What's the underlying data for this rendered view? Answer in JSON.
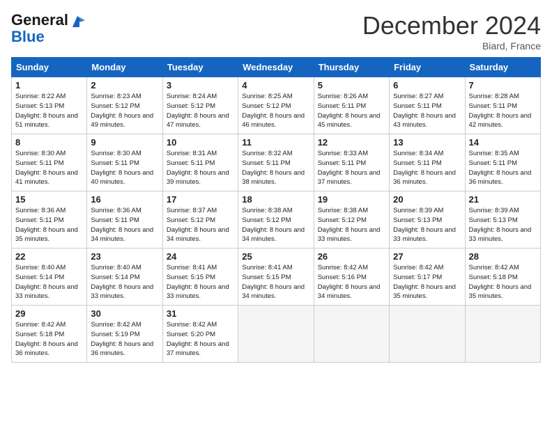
{
  "header": {
    "logo_general": "General",
    "logo_blue": "Blue",
    "month_title": "December 2024",
    "location": "Biard, France"
  },
  "days_of_week": [
    "Sunday",
    "Monday",
    "Tuesday",
    "Wednesday",
    "Thursday",
    "Friday",
    "Saturday"
  ],
  "weeks": [
    [
      {
        "day": "1",
        "sunrise": "Sunrise: 8:22 AM",
        "sunset": "Sunset: 5:13 PM",
        "daylight": "Daylight: 8 hours and 51 minutes."
      },
      {
        "day": "2",
        "sunrise": "Sunrise: 8:23 AM",
        "sunset": "Sunset: 5:12 PM",
        "daylight": "Daylight: 8 hours and 49 minutes."
      },
      {
        "day": "3",
        "sunrise": "Sunrise: 8:24 AM",
        "sunset": "Sunset: 5:12 PM",
        "daylight": "Daylight: 8 hours and 47 minutes."
      },
      {
        "day": "4",
        "sunrise": "Sunrise: 8:25 AM",
        "sunset": "Sunset: 5:12 PM",
        "daylight": "Daylight: 8 hours and 46 minutes."
      },
      {
        "day": "5",
        "sunrise": "Sunrise: 8:26 AM",
        "sunset": "Sunset: 5:11 PM",
        "daylight": "Daylight: 8 hours and 45 minutes."
      },
      {
        "day": "6",
        "sunrise": "Sunrise: 8:27 AM",
        "sunset": "Sunset: 5:11 PM",
        "daylight": "Daylight: 8 hours and 43 minutes."
      },
      {
        "day": "7",
        "sunrise": "Sunrise: 8:28 AM",
        "sunset": "Sunset: 5:11 PM",
        "daylight": "Daylight: 8 hours and 42 minutes."
      }
    ],
    [
      {
        "day": "8",
        "sunrise": "Sunrise: 8:30 AM",
        "sunset": "Sunset: 5:11 PM",
        "daylight": "Daylight: 8 hours and 41 minutes."
      },
      {
        "day": "9",
        "sunrise": "Sunrise: 8:30 AM",
        "sunset": "Sunset: 5:11 PM",
        "daylight": "Daylight: 8 hours and 40 minutes."
      },
      {
        "day": "10",
        "sunrise": "Sunrise: 8:31 AM",
        "sunset": "Sunset: 5:11 PM",
        "daylight": "Daylight: 8 hours and 39 minutes."
      },
      {
        "day": "11",
        "sunrise": "Sunrise: 8:32 AM",
        "sunset": "Sunset: 5:11 PM",
        "daylight": "Daylight: 8 hours and 38 minutes."
      },
      {
        "day": "12",
        "sunrise": "Sunrise: 8:33 AM",
        "sunset": "Sunset: 5:11 PM",
        "daylight": "Daylight: 8 hours and 37 minutes."
      },
      {
        "day": "13",
        "sunrise": "Sunrise: 8:34 AM",
        "sunset": "Sunset: 5:11 PM",
        "daylight": "Daylight: 8 hours and 36 minutes."
      },
      {
        "day": "14",
        "sunrise": "Sunrise: 8:35 AM",
        "sunset": "Sunset: 5:11 PM",
        "daylight": "Daylight: 8 hours and 36 minutes."
      }
    ],
    [
      {
        "day": "15",
        "sunrise": "Sunrise: 8:36 AM",
        "sunset": "Sunset: 5:11 PM",
        "daylight": "Daylight: 8 hours and 35 minutes."
      },
      {
        "day": "16",
        "sunrise": "Sunrise: 8:36 AM",
        "sunset": "Sunset: 5:11 PM",
        "daylight": "Daylight: 8 hours and 34 minutes."
      },
      {
        "day": "17",
        "sunrise": "Sunrise: 8:37 AM",
        "sunset": "Sunset: 5:12 PM",
        "daylight": "Daylight: 8 hours and 34 minutes."
      },
      {
        "day": "18",
        "sunrise": "Sunrise: 8:38 AM",
        "sunset": "Sunset: 5:12 PM",
        "daylight": "Daylight: 8 hours and 34 minutes."
      },
      {
        "day": "19",
        "sunrise": "Sunrise: 8:38 AM",
        "sunset": "Sunset: 5:12 PM",
        "daylight": "Daylight: 8 hours and 33 minutes."
      },
      {
        "day": "20",
        "sunrise": "Sunrise: 8:39 AM",
        "sunset": "Sunset: 5:13 PM",
        "daylight": "Daylight: 8 hours and 33 minutes."
      },
      {
        "day": "21",
        "sunrise": "Sunrise: 8:39 AM",
        "sunset": "Sunset: 5:13 PM",
        "daylight": "Daylight: 8 hours and 33 minutes."
      }
    ],
    [
      {
        "day": "22",
        "sunrise": "Sunrise: 8:40 AM",
        "sunset": "Sunset: 5:14 PM",
        "daylight": "Daylight: 8 hours and 33 minutes."
      },
      {
        "day": "23",
        "sunrise": "Sunrise: 8:40 AM",
        "sunset": "Sunset: 5:14 PM",
        "daylight": "Daylight: 8 hours and 33 minutes."
      },
      {
        "day": "24",
        "sunrise": "Sunrise: 8:41 AM",
        "sunset": "Sunset: 5:15 PM",
        "daylight": "Daylight: 8 hours and 33 minutes."
      },
      {
        "day": "25",
        "sunrise": "Sunrise: 8:41 AM",
        "sunset": "Sunset: 5:15 PM",
        "daylight": "Daylight: 8 hours and 34 minutes."
      },
      {
        "day": "26",
        "sunrise": "Sunrise: 8:42 AM",
        "sunset": "Sunset: 5:16 PM",
        "daylight": "Daylight: 8 hours and 34 minutes."
      },
      {
        "day": "27",
        "sunrise": "Sunrise: 8:42 AM",
        "sunset": "Sunset: 5:17 PM",
        "daylight": "Daylight: 8 hours and 35 minutes."
      },
      {
        "day": "28",
        "sunrise": "Sunrise: 8:42 AM",
        "sunset": "Sunset: 5:18 PM",
        "daylight": "Daylight: 8 hours and 35 minutes."
      }
    ],
    [
      {
        "day": "29",
        "sunrise": "Sunrise: 8:42 AM",
        "sunset": "Sunset: 5:18 PM",
        "daylight": "Daylight: 8 hours and 36 minutes."
      },
      {
        "day": "30",
        "sunrise": "Sunrise: 8:42 AM",
        "sunset": "Sunset: 5:19 PM",
        "daylight": "Daylight: 8 hours and 36 minutes."
      },
      {
        "day": "31",
        "sunrise": "Sunrise: 8:42 AM",
        "sunset": "Sunset: 5:20 PM",
        "daylight": "Daylight: 8 hours and 37 minutes."
      },
      null,
      null,
      null,
      null
    ]
  ]
}
